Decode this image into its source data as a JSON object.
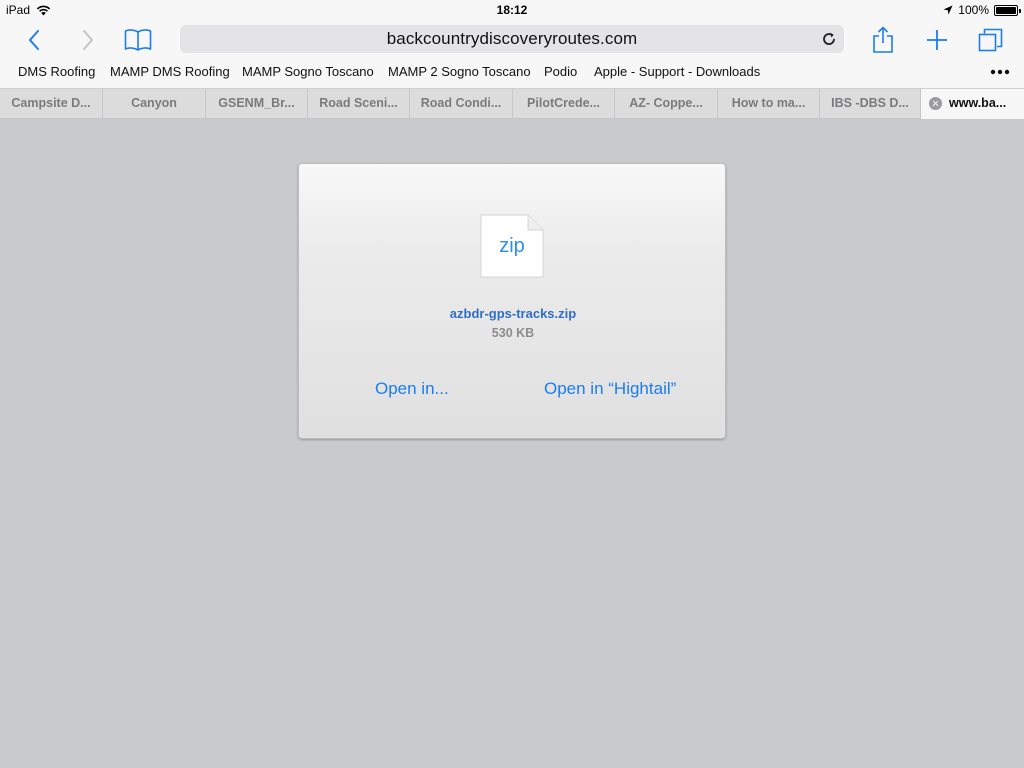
{
  "status_bar": {
    "device": "iPad",
    "time": "18:12",
    "battery": "100%",
    "battery_level": 1.0
  },
  "toolbar": {
    "url": "backcountrydiscoveryroutes.com",
    "icons": [
      "back-icon",
      "forward-icon",
      "bookmarks-icon",
      "reload-icon",
      "share-icon",
      "new-tab-icon",
      "tabs-icon"
    ]
  },
  "bookmarks": [
    "DMS Roofing",
    "MAMP DMS Roofing",
    "MAMP Sogno Toscano",
    "MAMP 2 Sogno Toscano",
    "Podio",
    "Apple - Support - Downloads"
  ],
  "tabs": [
    "Campsite D...",
    "Canyon",
    "GSENM_Br...",
    "Road Sceni...",
    "Road Condi...",
    "PilotCrede...",
    "AZ- Coppe...",
    "How to ma...",
    "IBS -DBS D...",
    "www.ba..."
  ],
  "download": {
    "file_ext": "zip",
    "file_name": "azbdr-gps-tracks.zip",
    "file_size": "530 KB",
    "open_in_label": "Open in...",
    "open_in_app_label": "Open in “Hightail”"
  },
  "colors": {
    "accent": "#1a7df0",
    "page_background": "#c9cacc",
    "chrome_background": "#f7f7f7"
  }
}
